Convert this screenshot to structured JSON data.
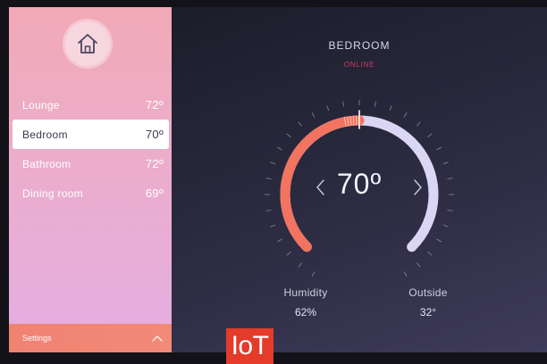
{
  "sidebar": {
    "home_icon": "home-icon",
    "rooms": [
      {
        "name": "Lounge",
        "temp": "72º"
      },
      {
        "name": "Bedroom",
        "temp": "70º",
        "active": true
      },
      {
        "name": "Bathroom",
        "temp": "72º"
      },
      {
        "name": "Dining room",
        "temp": "69º"
      }
    ],
    "settings_label": "Settings",
    "settings_icon": "chevron-up-icon"
  },
  "thermostat": {
    "room_title": "BEDROOM",
    "status": "ONLINE",
    "setpoint": "70º",
    "setpoint_fraction": 0.5,
    "prev_icon": "chevron-left-icon",
    "next_icon": "chevron-right-icon",
    "humidity_label": "Humidity",
    "humidity_value": "62%",
    "outside_label": "Outside",
    "outside_value": "32°"
  },
  "brand": {
    "logo_text": "IoT"
  },
  "colors": {
    "accent_coral": "#f2735f",
    "arc_inactive": "#dcd6f5",
    "status_red": "#cf3d5c",
    "sidebar_pink": "#f2a9b6",
    "sidebar_lilac": "#e4aee3",
    "panel_dark": "#1b1d2a",
    "logo_red": "#e43b2a"
  }
}
